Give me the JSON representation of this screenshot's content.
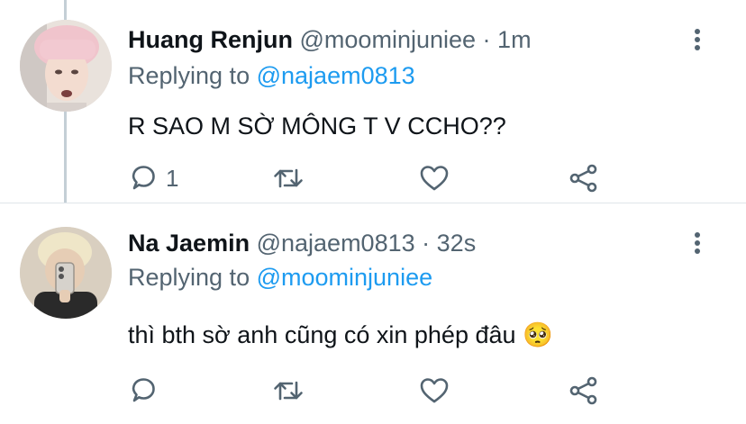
{
  "tweets": [
    {
      "display_name": "Huang Renjun",
      "handle": "@moominjuniee",
      "separator": "·",
      "time": "1m",
      "replying_prefix": "Replying to",
      "replying_to": "@najaem0813",
      "text": "R SAO M SỜ MÔNG T V CCHO??",
      "reply_count": "1",
      "retweet_count": "",
      "like_count": ""
    },
    {
      "display_name": "Na Jaemin",
      "handle": "@najaem0813",
      "separator": "·",
      "time": "32s",
      "replying_prefix": "Replying to",
      "replying_to": "@moominjuniee",
      "text": "thì bth sờ anh cũng có xin phép đâu",
      "emoji": "🥺",
      "reply_count": "",
      "retweet_count": "",
      "like_count": ""
    }
  ],
  "icons": {
    "reply": "reply-icon",
    "retweet": "retweet-icon",
    "like": "heart-icon",
    "share": "share-icon",
    "more": "more-vertical-icon"
  },
  "colors": {
    "text": "#0f1419",
    "secondary": "#536471",
    "link": "#1d9bf0",
    "thread_line": "#c4cfd6"
  }
}
